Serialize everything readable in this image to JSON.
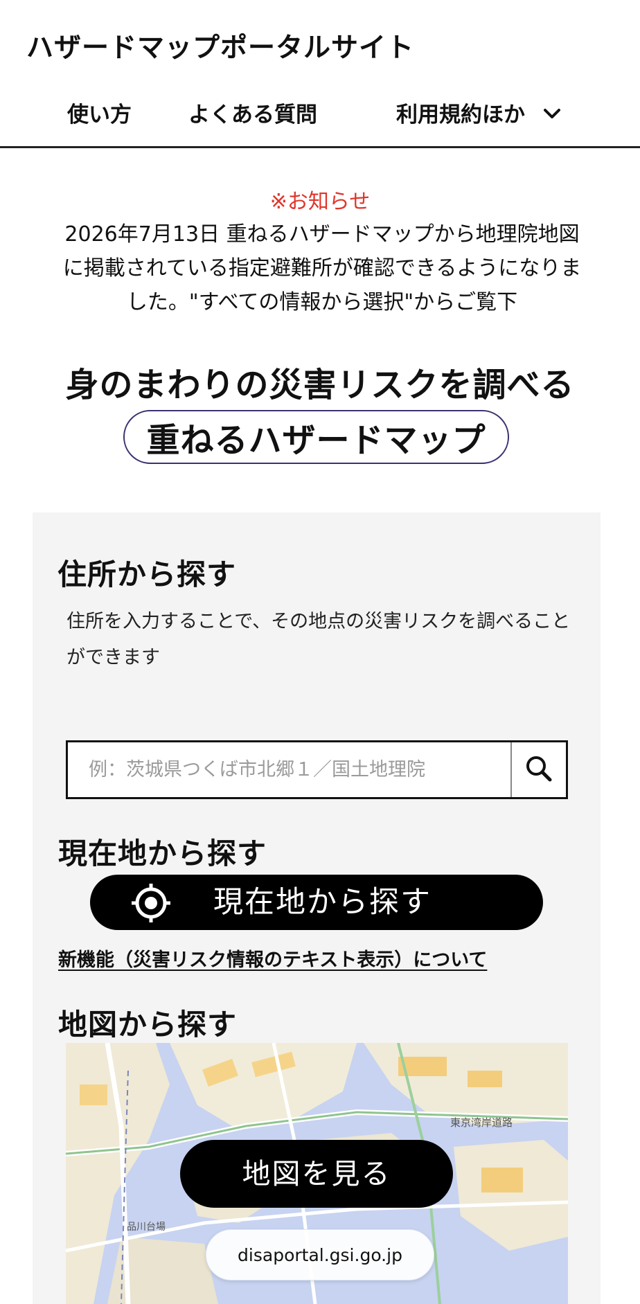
{
  "header": {
    "site_title": "ハザードマップポータルサイト",
    "nav": [
      {
        "label": "使い方"
      },
      {
        "label": "よくある質問"
      },
      {
        "label": "利用規約ほか"
      }
    ]
  },
  "notice": {
    "heading": "※お知らせ",
    "body": "2026年7月13日 重ねるハザードマップから地理院地図に掲載されている指定避難所が確認できるようになりました。\"すべての情報から選択\"からご覧下"
  },
  "hero": {
    "line": "身のまわりの災害リスクを調べる",
    "pill": "重ねるハザードマップ"
  },
  "address_search": {
    "heading": "住所から探す",
    "description": "住所を入力することで、その地点の災害リスクを調べることができます",
    "value": "",
    "placeholder": "例：茨城県つくば市北郷１／国土地理院"
  },
  "location_search": {
    "heading": "現在地から探す",
    "button_label": "現在地から探す",
    "new_feature_link": "新機能（災害リスク情報のテキスト表示）について"
  },
  "map_search": {
    "heading": "地図から探す",
    "button_label": "地図を見る",
    "labels": [
      "東京湾岸道路",
      "品川台場"
    ]
  },
  "url_bar": {
    "domain": "disaportal.gsi.go.jp"
  },
  "colors": {
    "notice_red": "#e0352b",
    "pill_border": "#3a3270",
    "panel_bg": "#f4f4f4",
    "map_water": "#c7d3f0"
  }
}
